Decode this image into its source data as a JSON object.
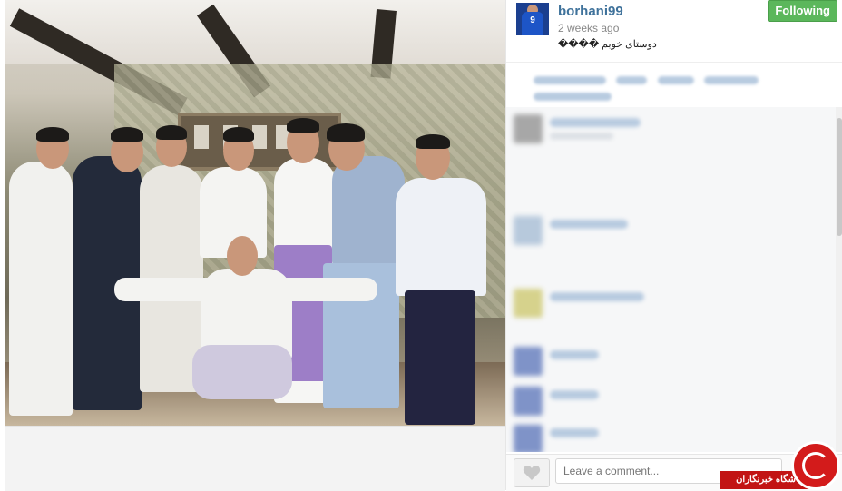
{
  "post": {
    "username": "borhani99",
    "timestamp": "2 weeks ago",
    "caption": "دوستای خوبم ����",
    "follow_label": "Following",
    "avatar_icon": "profile-avatar"
  },
  "comment_box": {
    "placeholder": "Leave a comment...",
    "like_icon": "heart-icon"
  },
  "watermark": {
    "text": "باشگاه خبرنگاران",
    "logo_icon": "news-agency-logo"
  },
  "colors": {
    "username": "#3f729b",
    "follow_button": "#5bb75b",
    "watermark": "#c21414"
  }
}
